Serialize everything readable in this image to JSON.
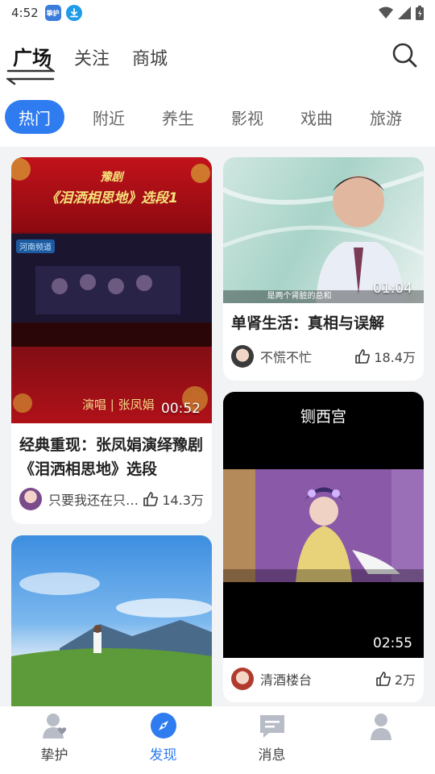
{
  "status_bar": {
    "time": "4:52",
    "app_badge": "挚护"
  },
  "header": {
    "top_tabs": [
      "广场",
      "关注",
      "商城"
    ],
    "active_top_tab": "广场"
  },
  "categories": [
    "热门",
    "附近",
    "养生",
    "影视",
    "戏曲",
    "旅游"
  ],
  "active_category": "热门",
  "cards": [
    {
      "title": "经典重现：张凤娟演绎豫剧《泪洒相思地》选段",
      "duration": "00:52",
      "author": "只要我还在只…",
      "likes": "14.3万",
      "thumb_text": {
        "genre": "豫剧",
        "heading": "《泪洒相思地》选段1",
        "station": "河南频道",
        "performer": "演唱 | 张凤娟"
      }
    },
    {
      "title": "单肾生活：真相与误解",
      "duration": "01:04",
      "author": "不慌不忙",
      "likes": "18.4万",
      "thumb_text": {
        "subtitle": "是两个肾脏的总和"
      }
    },
    {
      "title": "",
      "duration": "02:55",
      "author": "清酒楼台",
      "likes": "2万",
      "thumb_text": {
        "heading": "铡西宫"
      }
    }
  ],
  "bottom_nav": [
    {
      "label": "挚护",
      "icon": "person-heart-icon"
    },
    {
      "label": "发现",
      "icon": "compass-icon"
    },
    {
      "label": "消息",
      "icon": "message-icon"
    },
    {
      "label": "",
      "icon": "profile-icon"
    }
  ],
  "active_nav": "发现",
  "colors": {
    "accent": "#2f7bf0",
    "background": "#f2f3f5"
  }
}
